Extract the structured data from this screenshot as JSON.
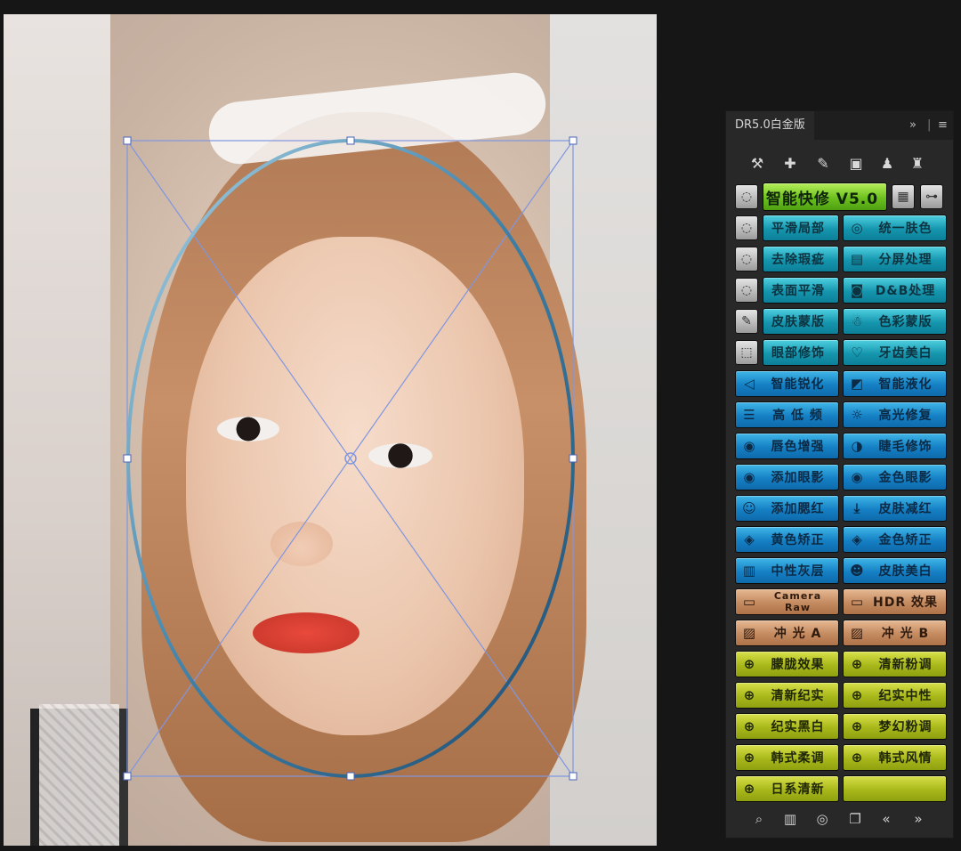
{
  "panel": {
    "tab_title": "DR5.0白金版",
    "expand_icon": "»",
    "menu_icon": "≡",
    "tools": [
      "brush-icon",
      "bandage-icon",
      "bandage-striped-icon",
      "chip-icon",
      "stamp-icon",
      "stamp-remove-icon"
    ],
    "title_button": "智能快修 V5.0",
    "side_minis": [
      "lasso-icon",
      "lasso-icon",
      "lasso-icon",
      "lasso-icon",
      "brush-icon",
      "marquee-icon"
    ],
    "rows": [
      {
        "left": {
          "label": "平滑局部",
          "icon": "",
          "color": "teal"
        },
        "right": {
          "label": "统一肤色",
          "icon": "◎",
          "color": "teal"
        }
      },
      {
        "left": {
          "label": "去除瑕疵",
          "icon": "",
          "color": "teal"
        },
        "right": {
          "label": "分屏处理",
          "icon": "▤",
          "color": "teal"
        }
      },
      {
        "left": {
          "label": "表面平滑",
          "icon": "",
          "color": "teal"
        },
        "right": {
          "label": "D&B处理",
          "icon": "◙",
          "color": "teal"
        }
      },
      {
        "left": {
          "label": "皮肤蒙版",
          "icon": "",
          "color": "teal"
        },
        "right": {
          "label": "色彩蒙版",
          "icon": "☃",
          "color": "teal"
        }
      },
      {
        "left": {
          "label": "眼部修饰",
          "icon": "",
          "color": "teal"
        },
        "right": {
          "label": "牙齿美白",
          "icon": "♡",
          "color": "teal"
        }
      },
      {
        "left": {
          "label": "智能锐化",
          "icon": "◁",
          "color": "blue"
        },
        "right": {
          "label": "智能液化",
          "icon": "◩",
          "color": "blue"
        }
      },
      {
        "left": {
          "label": "高 低 频",
          "icon": "☰",
          "color": "blue"
        },
        "right": {
          "label": "高光修复",
          "icon": "☼",
          "color": "blue"
        }
      },
      {
        "left": {
          "label": "唇色增强",
          "icon": "◉",
          "color": "blue"
        },
        "right": {
          "label": "睫毛修饰",
          "icon": "◑",
          "color": "blue"
        }
      },
      {
        "left": {
          "label": "添加眼影",
          "icon": "◉",
          "color": "blue"
        },
        "right": {
          "label": "金色眼影",
          "icon": "◉",
          "color": "blue"
        }
      },
      {
        "left": {
          "label": "添加腮红",
          "icon": "☺",
          "color": "blue"
        },
        "right": {
          "label": "皮肤减红",
          "icon": "⤓",
          "color": "blue"
        }
      },
      {
        "left": {
          "label": "黄色矫正",
          "icon": "◈",
          "color": "blue"
        },
        "right": {
          "label": "金色矫正",
          "icon": "◈",
          "color": "blue"
        }
      },
      {
        "left": {
          "label": "中性灰层",
          "icon": "▥",
          "color": "blue"
        },
        "right": {
          "label": "皮肤美白",
          "icon": "☻",
          "color": "blue"
        }
      },
      {
        "left": {
          "label": "Camera Raw",
          "icon": "▭",
          "color": "tan",
          "small": true
        },
        "right": {
          "label": "HDR 效果",
          "icon": "▭",
          "color": "tan"
        }
      },
      {
        "left": {
          "label": "冲 光 A",
          "icon": "▨",
          "color": "tan"
        },
        "right": {
          "label": "冲 光 B",
          "icon": "▨",
          "color": "tan"
        }
      },
      {
        "left": {
          "label": "朦胧效果",
          "icon": "⊕",
          "color": "lime"
        },
        "right": {
          "label": "清新粉调",
          "icon": "⊕",
          "color": "lime"
        }
      },
      {
        "left": {
          "label": "清新纪实",
          "icon": "⊕",
          "color": "lime"
        },
        "right": {
          "label": "纪实中性",
          "icon": "⊕",
          "color": "lime"
        }
      },
      {
        "left": {
          "label": "纪实黑白",
          "icon": "⊕",
          "color": "lime"
        },
        "right": {
          "label": "梦幻粉调",
          "icon": "⊕",
          "color": "lime"
        }
      },
      {
        "left": {
          "label": "韩式柔调",
          "icon": "⊕",
          "color": "lime"
        },
        "right": {
          "label": "韩式风情",
          "icon": "⊕",
          "color": "lime"
        }
      },
      {
        "left": {
          "label": "日系清新",
          "icon": "⊕",
          "color": "lime"
        },
        "right": {
          "label": "",
          "icon": "",
          "color": "lime"
        }
      }
    ],
    "bottom_icons": [
      "🔍",
      "▥",
      "◎",
      "❐",
      "«",
      "»"
    ]
  }
}
